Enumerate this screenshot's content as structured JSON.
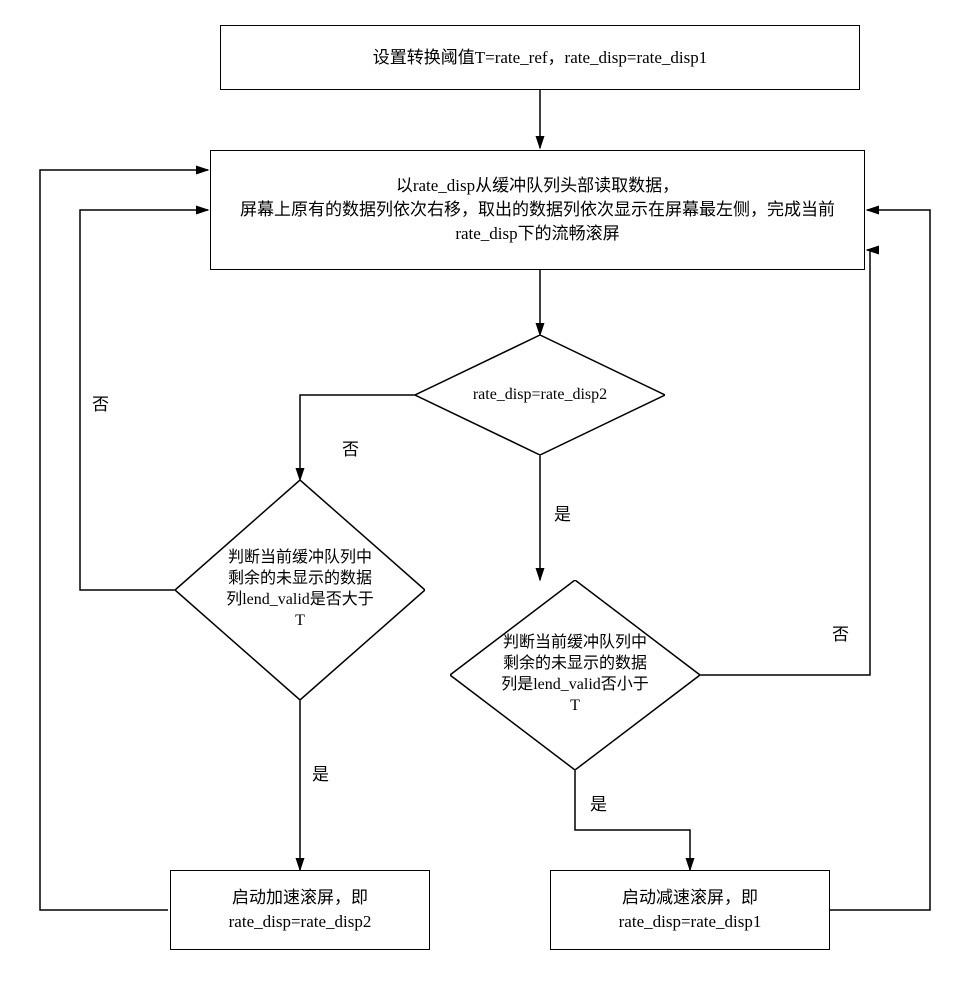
{
  "chart_data": {
    "type": "flowchart",
    "title": "",
    "nodes": [
      {
        "id": "n1",
        "shape": "rect",
        "text": "设置转换阈值T=rate_ref，rate_disp=rate_disp1"
      },
      {
        "id": "n2",
        "shape": "rect",
        "text": "以rate_disp从缓冲队列头部读取数据，\n屏幕上原有的数据列依次右移，取出的数据列依次显示在屏幕最左侧，完成当前rate_disp下的流畅滚屏"
      },
      {
        "id": "n3",
        "shape": "diamond",
        "text": "rate_disp=rate_disp2"
      },
      {
        "id": "n4",
        "shape": "diamond",
        "text": "判断当前缓冲队列中剩余的未显示的数据列lend_valid是否大于T"
      },
      {
        "id": "n5",
        "shape": "diamond",
        "text": "判断当前缓冲队列中剩余的未显示的数据列是lend_valid否小于T"
      },
      {
        "id": "n6",
        "shape": "rect",
        "text": "启动加速滚屏，即rate_disp=rate_disp2"
      },
      {
        "id": "n7",
        "shape": "rect",
        "text": "启动减速滚屏，即rate_disp=rate_disp1"
      }
    ],
    "edges": [
      {
        "from": "n1",
        "to": "n2",
        "label": ""
      },
      {
        "from": "n2",
        "to": "n3",
        "label": ""
      },
      {
        "from": "n3",
        "to": "n4",
        "label": "否"
      },
      {
        "from": "n3",
        "to": "n5",
        "label": "是"
      },
      {
        "from": "n4",
        "to": "n6",
        "label": "是"
      },
      {
        "from": "n4",
        "to": "n2",
        "label": "否"
      },
      {
        "from": "n5",
        "to": "n7",
        "label": "是"
      },
      {
        "from": "n5",
        "to": "n2",
        "label": "否"
      },
      {
        "from": "n6",
        "to": "n2",
        "label": ""
      },
      {
        "from": "n7",
        "to": "n2",
        "label": ""
      }
    ],
    "labels": {
      "yes": "是",
      "no": "否"
    }
  }
}
